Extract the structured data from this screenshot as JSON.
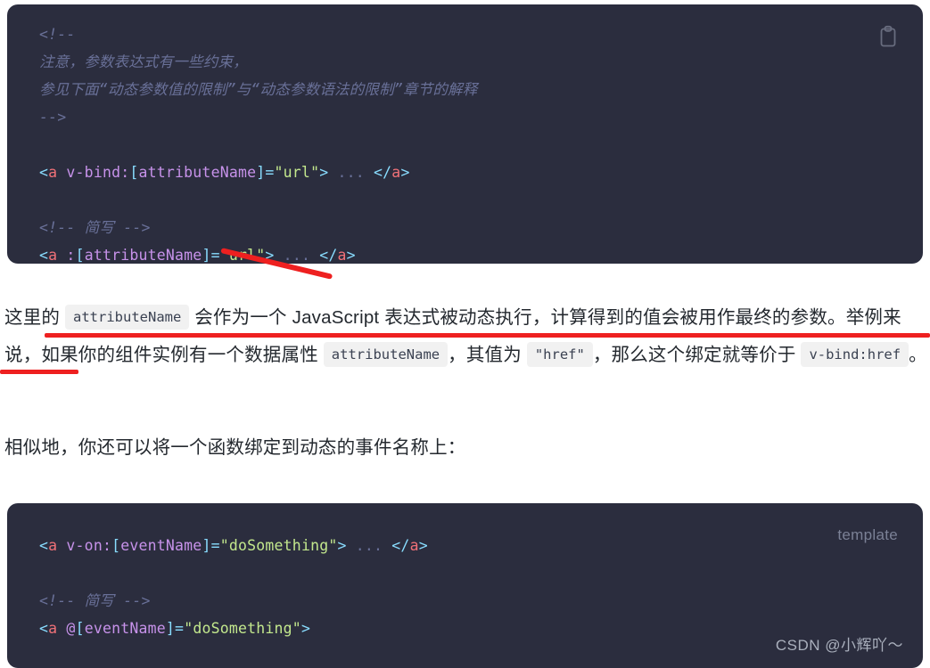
{
  "code_block_1": {
    "lines": [
      [
        {
          "text": "<!--",
          "token": "comment"
        }
      ],
      [
        {
          "text": "注意，参数表达式有一些约束，",
          "token": "comment"
        }
      ],
      [
        {
          "text": "参见下面“动态参数值的限制”与“动态参数语法的限制”章节的解释",
          "token": "comment"
        }
      ],
      [
        {
          "text": "-->",
          "token": "comment"
        }
      ],
      [],
      [
        {
          "text": "<",
          "token": "punct"
        },
        {
          "text": "a",
          "token": "tag"
        },
        {
          "text": " v-bind:",
          "token": "attr"
        },
        {
          "text": "[",
          "token": "punct"
        },
        {
          "text": "attributeName",
          "token": "attr"
        },
        {
          "text": "]=",
          "token": "punct"
        },
        {
          "text": "\"url\"",
          "token": "string"
        },
        {
          "text": ">",
          "token": "punct"
        },
        {
          "text": " ... ",
          "token": "dots"
        },
        {
          "text": "</",
          "token": "punct"
        },
        {
          "text": "a",
          "token": "tag"
        },
        {
          "text": ">",
          "token": "punct"
        }
      ],
      [],
      [
        {
          "text": "<!-- 简写 -->",
          "token": "comment"
        }
      ],
      [
        {
          "text": "<",
          "token": "punct"
        },
        {
          "text": "a",
          "token": "tag"
        },
        {
          "text": " :",
          "token": "attr"
        },
        {
          "text": "[",
          "token": "punct"
        },
        {
          "text": "attributeName",
          "token": "attr"
        },
        {
          "text": "]=",
          "token": "punct"
        },
        {
          "text": "\"url\"",
          "token": "string"
        },
        {
          "text": ">",
          "token": "punct"
        },
        {
          "text": " ... ",
          "token": "dots"
        },
        {
          "text": "</",
          "token": "punct"
        },
        {
          "text": "a",
          "token": "tag"
        },
        {
          "text": ">",
          "token": "punct"
        }
      ]
    ],
    "copy_icon": "clipboard-copy-icon"
  },
  "code_block_2": {
    "language_label": "template",
    "lines": [
      [
        {
          "text": "<",
          "token": "punct"
        },
        {
          "text": "a",
          "token": "tag"
        },
        {
          "text": " v-on:",
          "token": "attr"
        },
        {
          "text": "[",
          "token": "punct"
        },
        {
          "text": "eventName",
          "token": "attr"
        },
        {
          "text": "]=",
          "token": "punct"
        },
        {
          "text": "\"doSomething\"",
          "token": "string"
        },
        {
          "text": ">",
          "token": "punct"
        },
        {
          "text": " ... ",
          "token": "dots"
        },
        {
          "text": "</",
          "token": "punct"
        },
        {
          "text": "a",
          "token": "tag"
        },
        {
          "text": ">",
          "token": "punct"
        }
      ],
      [],
      [
        {
          "text": "<!-- 简写 -->",
          "token": "comment"
        }
      ],
      [
        {
          "text": "<",
          "token": "punct"
        },
        {
          "text": "a",
          "token": "tag"
        },
        {
          "text": " @",
          "token": "attr"
        },
        {
          "text": "[",
          "token": "punct"
        },
        {
          "text": "eventName",
          "token": "attr"
        },
        {
          "text": "]=",
          "token": "punct"
        },
        {
          "text": "\"doSomething\"",
          "token": "string"
        },
        {
          "text": ">",
          "token": "punct"
        }
      ]
    ],
    "watermark": "CSDN @小辉吖～"
  },
  "paragraph_1": [
    {
      "text": "这里的 ",
      "type": "text"
    },
    {
      "text": "attributeName",
      "type": "code"
    },
    {
      "text": " 会作为一个 JavaScript 表达式被动态执行，计算得到的值会被用作最终的参数。举例来说，如果你的组件实例有一个数据属性 ",
      "type": "text"
    },
    {
      "text": "attributeName",
      "type": "code"
    },
    {
      "text": "，其值为 ",
      "type": "text"
    },
    {
      "text": "\"href\"",
      "type": "code"
    },
    {
      "text": "，那么这个绑定就等价于 ",
      "type": "text"
    },
    {
      "text": "v-bind:href",
      "type": "code"
    },
    {
      "text": "。",
      "type": "text"
    }
  ],
  "paragraph_2": [
    {
      "text": "相似地，你还可以将一个函数绑定到动态的事件名称上：",
      "type": "text"
    }
  ],
  "annotations": {
    "color": "#ee2020",
    "items": [
      {
        "name": "red-underline-paragraph-line-1",
        "shape": "line"
      },
      {
        "name": "red-underline-paragraph-line-2",
        "shape": "line"
      },
      {
        "name": "red-arrow-stroke-attribute-name",
        "shape": "diagonal-line"
      }
    ]
  },
  "theme": {
    "code_background": "#2b2d3e",
    "page_background": "#ffffff",
    "text_color": "#24292f",
    "inline_code_background": "#f1f1f1",
    "token_punct": "#89ddff",
    "token_tag": "#f07178",
    "token_attr": "#c792ea",
    "token_string": "#c3e88d",
    "token_comment": "#697098"
  }
}
